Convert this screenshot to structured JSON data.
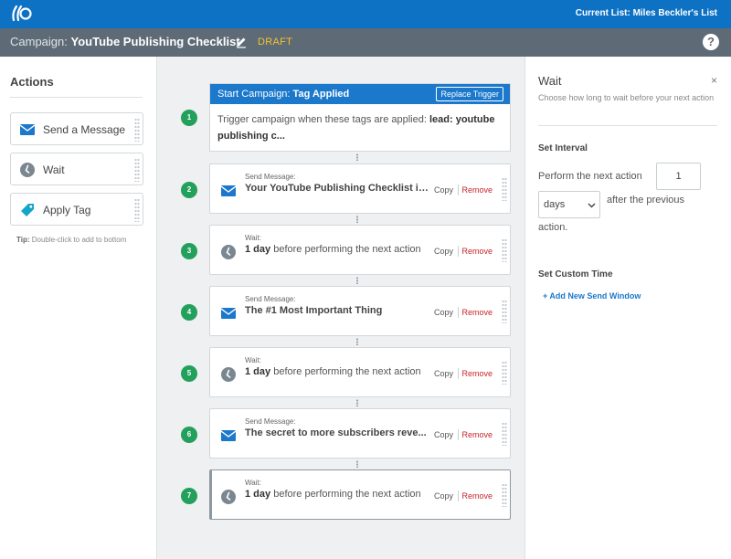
{
  "topbar": {
    "current_list": "Current List: Miles Beckler's List"
  },
  "campaign": {
    "prefix": "Campaign:",
    "name": "YouTube Publishing Checklist",
    "status": "DRAFT",
    "help": "?"
  },
  "actions_panel": {
    "title": "Actions",
    "items": [
      {
        "label": "Send a Message",
        "icon": "envelope-icon"
      },
      {
        "label": "Wait",
        "icon": "clock-icon"
      },
      {
        "label": "Apply Tag",
        "icon": "tag-icon"
      }
    ],
    "tip_label": "Tip:",
    "tip_text": "Double-click to add to bottom"
  },
  "trigger": {
    "number": "1",
    "head_prefix": "Start Campaign:",
    "head_bold": "Tag Applied",
    "replace_label": "Replace Trigger",
    "body_prefix": "Trigger campaign when these tags are applied:",
    "body_bold": "lead: youtube publishing c..."
  },
  "steps": [
    {
      "number": "2",
      "type": "Send Message:",
      "text": "Your YouTube Publishing Checklist is...",
      "icon": "envelope-icon"
    },
    {
      "number": "3",
      "type": "Wait:",
      "bold": "1 day",
      "text": "before performing the next action",
      "icon": "clock-icon"
    },
    {
      "number": "4",
      "type": "Send Message:",
      "text": "The #1 Most Important Thing",
      "icon": "envelope-icon"
    },
    {
      "number": "5",
      "type": "Wait:",
      "bold": "1 day",
      "text": "before performing the next action",
      "icon": "clock-icon"
    },
    {
      "number": "6",
      "type": "Send Message:",
      "text": "The secret to more subscribers reve...",
      "icon": "envelope-icon"
    },
    {
      "number": "7",
      "type": "Wait:",
      "bold": "1 day",
      "text": "before performing the next action",
      "icon": "clock-icon"
    }
  ],
  "card_actions": {
    "copy": "Copy",
    "remove": "Remove"
  },
  "right_panel": {
    "title": "Wait",
    "close": "×",
    "description": "Choose how long to wait before your next action",
    "set_interval": "Set Interval",
    "perform_label": "Perform the next action",
    "interval_value": "1",
    "unit_value": "days",
    "after_label": "after the previous",
    "action_label": "action.",
    "set_custom_time": "Set Custom Time",
    "add_window": "+ Add New Send Window"
  },
  "colors": {
    "brand_blue": "#0d72c4",
    "step_green": "#23a05c",
    "remove_red": "#c8242b",
    "draft_yellow": "#f2c230"
  }
}
